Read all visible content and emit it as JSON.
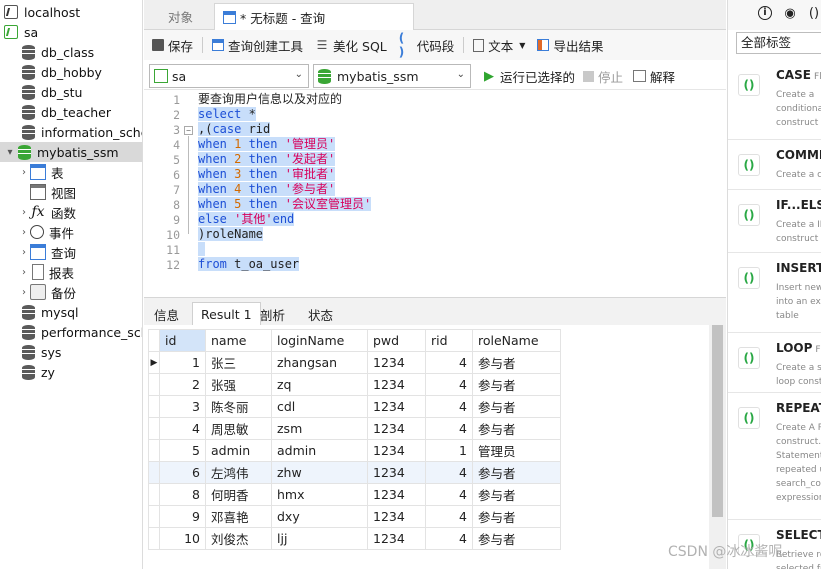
{
  "tree": {
    "items": [
      {
        "label": "localhost",
        "kind": "conn"
      },
      {
        "label": "sa",
        "kind": "conn-green"
      },
      {
        "label": "db_class",
        "kind": "db"
      },
      {
        "label": "db_hobby",
        "kind": "db"
      },
      {
        "label": "db_stu",
        "kind": "db"
      },
      {
        "label": "db_teacher",
        "kind": "db"
      },
      {
        "label": "information_sche",
        "kind": "db"
      },
      {
        "label": "mybatis_ssm",
        "kind": "db-open"
      },
      {
        "label": "表",
        "kind": "sub"
      },
      {
        "label": "视图",
        "kind": "sub"
      },
      {
        "label": "函数",
        "kind": "sub"
      },
      {
        "label": "事件",
        "kind": "sub"
      },
      {
        "label": "查询",
        "kind": "sub"
      },
      {
        "label": "报表",
        "kind": "sub"
      },
      {
        "label": "备份",
        "kind": "sub"
      },
      {
        "label": "mysql",
        "kind": "db"
      },
      {
        "label": "performance_sch",
        "kind": "db"
      },
      {
        "label": "sys",
        "kind": "db"
      },
      {
        "label": "zy",
        "kind": "db"
      }
    ]
  },
  "tabs": {
    "objects": "对象",
    "query": "* 无标题 - 查询"
  },
  "toolbar": {
    "save": "保存",
    "builder": "查询创建工具",
    "beautify": "美化 SQL",
    "snippet": "代码段",
    "text": "文本",
    "export": "导出结果"
  },
  "runbar": {
    "connection": "sa",
    "database": "mybatis_ssm",
    "run": "运行已选择的",
    "stop": "停止",
    "explain": "解释"
  },
  "editor": {
    "line_numbers": [
      "1",
      "2",
      "3",
      "4",
      "5",
      "6",
      "7",
      "8",
      "9",
      "10",
      "11",
      "12"
    ]
  },
  "bottom_tabs": [
    "信息",
    "Result 1",
    "剖析",
    "状态"
  ],
  "grid": {
    "columns": [
      "id",
      "name",
      "loginName",
      "pwd",
      "rid",
      "roleName"
    ],
    "rows": [
      [
        "1",
        "张三",
        "zhangsan",
        "1234",
        "4",
        "参与者"
      ],
      [
        "2",
        "张强",
        "zq",
        "1234",
        "4",
        "参与者"
      ],
      [
        "3",
        "陈冬丽",
        "cdl",
        "1234",
        "4",
        "参与者"
      ],
      [
        "4",
        "周思敏",
        "zsm",
        "1234",
        "4",
        "参与者"
      ],
      [
        "5",
        "admin",
        "admin",
        "1234",
        "1",
        "管理员"
      ],
      [
        "6",
        "左鸿伟",
        "zhw",
        "1234",
        "4",
        "参与者"
      ],
      [
        "8",
        "何明香",
        "hmx",
        "1234",
        "4",
        "参与者"
      ],
      [
        "9",
        "邓喜艳",
        "dxy",
        "1234",
        "4",
        "参与者"
      ],
      [
        "10",
        "刘俊杰",
        "ljj",
        "1234",
        "4",
        "参与者"
      ]
    ]
  },
  "right_panel": {
    "filter": "全部标签",
    "snippets": [
      {
        "title": "CASE",
        "tag": "Flo",
        "desc": [
          "Create a",
          "conditional",
          "construct"
        ]
      },
      {
        "title": "COMMI",
        "tag": "",
        "desc": [
          "Create a c"
        ]
      },
      {
        "title": "IF...ELSE",
        "tag": "",
        "desc": [
          "Create a IF",
          "construct"
        ]
      },
      {
        "title": "INSERT",
        "tag": "",
        "desc": [
          "Insert new",
          "into an ex",
          "table"
        ]
      },
      {
        "title": "LOOP",
        "tag": "Flo",
        "desc": [
          "Create a si",
          "loop const"
        ]
      },
      {
        "title": "REPEAT",
        "tag": "",
        "desc": [
          "Create A R",
          "construct.",
          "Statement",
          "repeated u",
          "search_con",
          "expression"
        ]
      },
      {
        "title": "SELECT",
        "tag": "",
        "desc": [
          "Retrieve ro",
          "selected fr"
        ]
      }
    ]
  },
  "watermark": "CSDN @冰冰酱呢"
}
